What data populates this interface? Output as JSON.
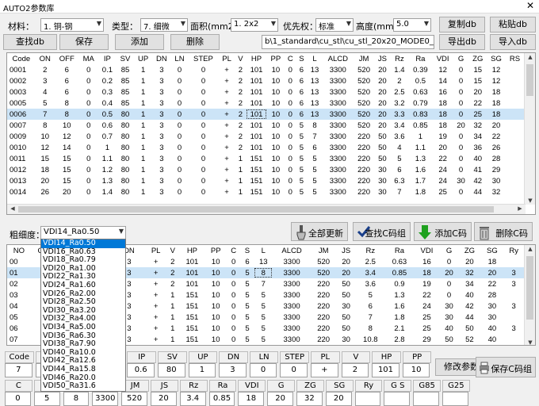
{
  "window": {
    "title": "AUTO2参数库",
    "close": "✕"
  },
  "toolbar": {
    "material_label": "材料：",
    "material_value": "1. 铜-钢",
    "type_label": "类型：",
    "type_value": "7. 细微",
    "area_label": "面积(mm2):",
    "area_value": "1. 2x2",
    "priority_label": "优先权：",
    "priority_value": "标准",
    "height_label": "高度(mm):",
    "height_value": "5.0",
    "copy_db": "复制db",
    "paste_db": "粘贴db",
    "find_db": "查找db",
    "save": "保存",
    "add": "添加",
    "delete": "删除",
    "db_path": "b\\1_standard\\cu_stl\\cu_stl_20x20_MODE0_5.0mm.db",
    "export_db": "导出db",
    "import_db": "导入db"
  },
  "top_table": {
    "columns": [
      "Code",
      "ON",
      "OFF",
      "MA",
      "IP",
      "SV",
      "UP",
      "DN",
      "LN",
      "STEP",
      "PL",
      "V",
      "HP",
      "PP",
      "C",
      "S",
      "L",
      "ALCD",
      "JM",
      "JS",
      "Rz",
      "Ra",
      "VDI",
      "G",
      "ZG",
      "SG",
      "RS"
    ],
    "rows": [
      [
        "0001",
        "2",
        "6",
        "0",
        "0.1",
        "85",
        "1",
        "3",
        "0",
        "0",
        "+",
        "2",
        "101",
        "10",
        "0",
        "6",
        "13",
        "3300",
        "520",
        "20",
        "1.4",
        "0.39",
        "12",
        "0",
        "15",
        "12",
        ""
      ],
      [
        "0002",
        "3",
        "6",
        "0",
        "0.2",
        "85",
        "1",
        "3",
        "0",
        "0",
        "+",
        "2",
        "101",
        "10",
        "0",
        "6",
        "13",
        "3300",
        "520",
        "20",
        "2",
        "0.5",
        "14",
        "0",
        "15",
        "12",
        ""
      ],
      [
        "0003",
        "4",
        "6",
        "0",
        "0.3",
        "85",
        "1",
        "3",
        "0",
        "0",
        "+",
        "2",
        "101",
        "10",
        "0",
        "6",
        "13",
        "3300",
        "520",
        "20",
        "2.5",
        "0.63",
        "16",
        "0",
        "20",
        "18",
        ""
      ],
      [
        "0005",
        "5",
        "8",
        "0",
        "0.4",
        "85",
        "1",
        "3",
        "0",
        "0",
        "+",
        "2",
        "101",
        "10",
        "0",
        "6",
        "13",
        "3300",
        "520",
        "20",
        "3.2",
        "0.79",
        "18",
        "0",
        "22",
        "18",
        ""
      ],
      [
        "0006",
        "7",
        "8",
        "0",
        "0.5",
        "80",
        "1",
        "3",
        "0",
        "0",
        "+",
        "2",
        "101",
        "10",
        "0",
        "6",
        "13",
        "3300",
        "520",
        "20",
        "3.3",
        "0.83",
        "18",
        "0",
        "25",
        "18",
        ""
      ],
      [
        "0007",
        "8",
        "10",
        "0",
        "0.6",
        "80",
        "1",
        "3",
        "0",
        "0",
        "+",
        "2",
        "101",
        "10",
        "0",
        "5",
        "8",
        "3300",
        "520",
        "20",
        "3.4",
        "0.85",
        "18",
        "20",
        "32",
        "20",
        ""
      ],
      [
        "0009",
        "10",
        "12",
        "0",
        "0.7",
        "80",
        "1",
        "3",
        "0",
        "0",
        "+",
        "2",
        "101",
        "10",
        "0",
        "5",
        "7",
        "3300",
        "220",
        "50",
        "3.6",
        "1",
        "19",
        "0",
        "34",
        "22",
        ""
      ],
      [
        "0010",
        "12",
        "14",
        "0",
        "1",
        "80",
        "1",
        "3",
        "0",
        "0",
        "+",
        "2",
        "101",
        "10",
        "0",
        "5",
        "6",
        "3300",
        "220",
        "50",
        "4",
        "1.1",
        "20",
        "0",
        "36",
        "26",
        ""
      ],
      [
        "0011",
        "15",
        "15",
        "0",
        "1.1",
        "80",
        "1",
        "3",
        "0",
        "0",
        "+",
        "1",
        "151",
        "10",
        "0",
        "5",
        "5",
        "3300",
        "220",
        "50",
        "5",
        "1.3",
        "22",
        "0",
        "40",
        "28",
        ""
      ],
      [
        "0012",
        "18",
        "15",
        "0",
        "1.2",
        "80",
        "1",
        "3",
        "0",
        "0",
        "+",
        "1",
        "151",
        "10",
        "0",
        "5",
        "5",
        "3300",
        "220",
        "30",
        "6",
        "1.6",
        "24",
        "0",
        "41",
        "29",
        ""
      ],
      [
        "0013",
        "20",
        "15",
        "0",
        "1.3",
        "80",
        "1",
        "3",
        "0",
        "0",
        "+",
        "1",
        "151",
        "10",
        "0",
        "5",
        "5",
        "3300",
        "220",
        "30",
        "6.3",
        "1.7",
        "24",
        "30",
        "42",
        "30",
        ""
      ],
      [
        "0014",
        "26",
        "20",
        "0",
        "1.4",
        "80",
        "1",
        "3",
        "0",
        "0",
        "+",
        "1",
        "151",
        "10",
        "0",
        "5",
        "5",
        "3300",
        "220",
        "30",
        "7",
        "1.8",
        "25",
        "0",
        "44",
        "32",
        ""
      ]
    ]
  },
  "middle": {
    "roughness_label": "粗细度：",
    "roughness_value": "VDI14_Ra0.50",
    "update_all": "全部更新",
    "find_c": "查找C码组",
    "add_c": "添加C码",
    "delete_c": "删除C码"
  },
  "dropdown_options": [
    "VDI14_Ra0.50",
    "VDI16_Ra0.63",
    "VDI18_Ra0.79",
    "VDI20_Ra1.00",
    "VDI22_Ra1.30",
    "VDI24_Ra1.60",
    "VDI26_Ra2.00",
    "VDI28_Ra2.50",
    "VDI30_Ra3.20",
    "VDI32_Ra4.00",
    "VDI34_Ra5.00",
    "VDI36_Ra6.30",
    "VDI38_Ra7.90",
    "VDI40_Ra10.0",
    "VDI42_Ra12.6",
    "VDI44_Ra15.8",
    "VDI46_Ra20.0",
    "VDI50_Ra31.6"
  ],
  "bottom_table": {
    "columns": [
      "NO",
      "Cod",
      "",
      "",
      "",
      "SV",
      "UP",
      "DN",
      "",
      "PL",
      "V",
      "HP",
      "PP",
      "C",
      "S",
      "L",
      "ALCD",
      "JM",
      "JS",
      "Rz",
      "Ra",
      "VDI",
      "G",
      "ZG",
      "SG",
      "Ry"
    ],
    "rows": [
      [
        "00",
        "",
        "",
        "",
        "",
        "85",
        "1",
        "3",
        "",
        "+",
        "2",
        "101",
        "10",
        "0",
        "6",
        "13",
        "3300",
        "520",
        "20",
        "2.5",
        "0.63",
        "16",
        "0",
        "20",
        "18",
        ""
      ],
      [
        "01",
        "7",
        "",
        "",
        "",
        "80",
        "1",
        "3",
        "",
        "+",
        "2",
        "101",
        "10",
        "0",
        "5",
        "8",
        "3300",
        "520",
        "20",
        "3.4",
        "0.85",
        "18",
        "20",
        "32",
        "20",
        "3"
      ],
      [
        "02",
        "9",
        "",
        "",
        "",
        "80",
        "1",
        "3",
        "",
        "+",
        "2",
        "101",
        "10",
        "0",
        "5",
        "7",
        "3300",
        "220",
        "50",
        "3.6",
        "0.9",
        "19",
        "0",
        "34",
        "22",
        "3"
      ],
      [
        "03",
        "13",
        "",
        "",
        "",
        "80",
        "1",
        "3",
        "",
        "+",
        "1",
        "151",
        "10",
        "0",
        "5",
        "5",
        "3300",
        "220",
        "50",
        "5",
        "1.3",
        "22",
        "0",
        "40",
        "28",
        ""
      ],
      [
        "04",
        "14",
        "",
        "",
        "",
        "80",
        "1",
        "3",
        "",
        "+",
        "1",
        "151",
        "10",
        "0",
        "5",
        "5",
        "3300",
        "220",
        "30",
        "6",
        "1.6",
        "24",
        "30",
        "42",
        "30",
        "3"
      ],
      [
        "05",
        "18",
        "",
        "",
        "",
        "75",
        "1",
        "3",
        "",
        "+",
        "1",
        "151",
        "10",
        "0",
        "5",
        "5",
        "3300",
        "220",
        "50",
        "7",
        "1.8",
        "25",
        "30",
        "44",
        "30",
        ""
      ],
      [
        "06",
        "15",
        "",
        "",
        "",
        "75",
        "1",
        "3",
        "",
        "+",
        "1",
        "151",
        "10",
        "0",
        "5",
        "5",
        "3300",
        "220",
        "50",
        "8",
        "2.1",
        "25",
        "40",
        "50",
        "40",
        "3"
      ],
      [
        "07",
        "19",
        "",
        "",
        "",
        "75",
        "1",
        "3",
        "",
        "+",
        "1",
        "151",
        "10",
        "0",
        "5",
        "5",
        "3300",
        "220",
        "30",
        "10.8",
        "2.8",
        "29",
        "50",
        "52",
        "40",
        ""
      ]
    ]
  },
  "form": {
    "row1_labels": [
      "Code",
      "ON",
      "",
      "",
      "IP",
      "SV",
      "UP",
      "DN",
      "LN",
      "STEP",
      "PL",
      "V",
      "HP",
      "PP"
    ],
    "row1_values": [
      "7",
      "",
      "",
      "",
      "0.6",
      "80",
      "1",
      "3",
      "0",
      "0",
      "+",
      "2",
      "101",
      "10"
    ],
    "row2_labels": [
      "C",
      "S",
      "L",
      "ALCD",
      "JM",
      "JS",
      "Rz",
      "Ra",
      "VDI",
      "G",
      "ZG",
      "SG",
      "Ry",
      "G S",
      "G85",
      "G25"
    ],
    "row2_values": [
      "0",
      "5",
      "8",
      "3300",
      "520",
      "20",
      "3.4",
      "0.85",
      "18",
      "20",
      "32",
      "20",
      "",
      "",
      "",
      ""
    ],
    "modify_param": "修改参数",
    "save_c": "保存C码组"
  }
}
